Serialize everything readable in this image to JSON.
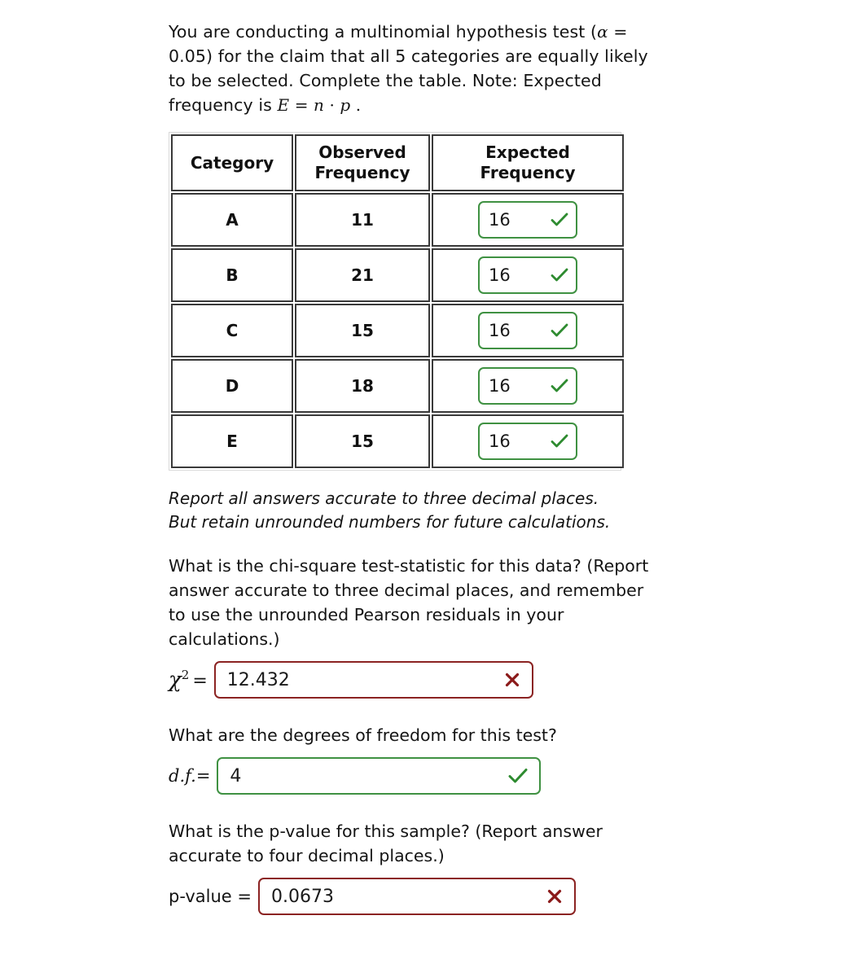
{
  "problem": {
    "intro_line1": "You are conducting a multinomial hypothesis test (",
    "intro_alpha": "α",
    "intro_line2": " = 0.05) for the claim that all 5 categories are equally likely to be selected. Complete the table. Note: Expected frequency is ",
    "intro_formula_E": "E",
    "intro_formula_eq": " = ",
    "intro_formula_n": "n",
    "intro_formula_dot": " · ",
    "intro_formula_p": "p",
    "intro_formula_end": " ."
  },
  "table": {
    "headers": {
      "category": "Category",
      "observed_line1": "Observed",
      "observed_line2": "Frequency",
      "expected_line1": "Expected",
      "expected_line2": "Frequency"
    },
    "rows": [
      {
        "category": "A",
        "observed": "11",
        "expected": "16",
        "status": "correct"
      },
      {
        "category": "B",
        "observed": "21",
        "expected": "16",
        "status": "correct"
      },
      {
        "category": "C",
        "observed": "15",
        "expected": "16",
        "status": "correct"
      },
      {
        "category": "D",
        "observed": "18",
        "expected": "16",
        "status": "correct"
      },
      {
        "category": "E",
        "observed": "15",
        "expected": "16",
        "status": "correct"
      }
    ]
  },
  "note": {
    "line1": "Report all answers accurate to three decimal places.",
    "line2": "But retain unrounded numbers for future calculations."
  },
  "chi_square": {
    "question": "What is the chi-square test-statistic for this data? (Report answer accurate to three decimal places, and remember to use the unrounded Pearson residuals in your calculations.)",
    "label_symbol": "χ",
    "label_exponent": "2",
    "label_equals": "=",
    "value": "12.432",
    "status": "incorrect"
  },
  "degrees_of_freedom": {
    "question": "What are the degrees of freedom for this test?",
    "label": "d.f.=",
    "value": "4",
    "status": "correct"
  },
  "p_value": {
    "question": "What is the p-value for this sample? (Report answer accurate to four decimal places.)",
    "label": "p-value =",
    "value": "0.0673",
    "status": "incorrect"
  },
  "colors": {
    "correct_border": "#3f9142",
    "correct_mark": "#2e8b30",
    "incorrect_border": "#8b2322",
    "incorrect_mark": "#8b1a1a",
    "table_border": "#3a3a3a",
    "text": "#141414"
  },
  "icons": {
    "correct": "checkmark-icon",
    "incorrect": "cross-icon"
  }
}
